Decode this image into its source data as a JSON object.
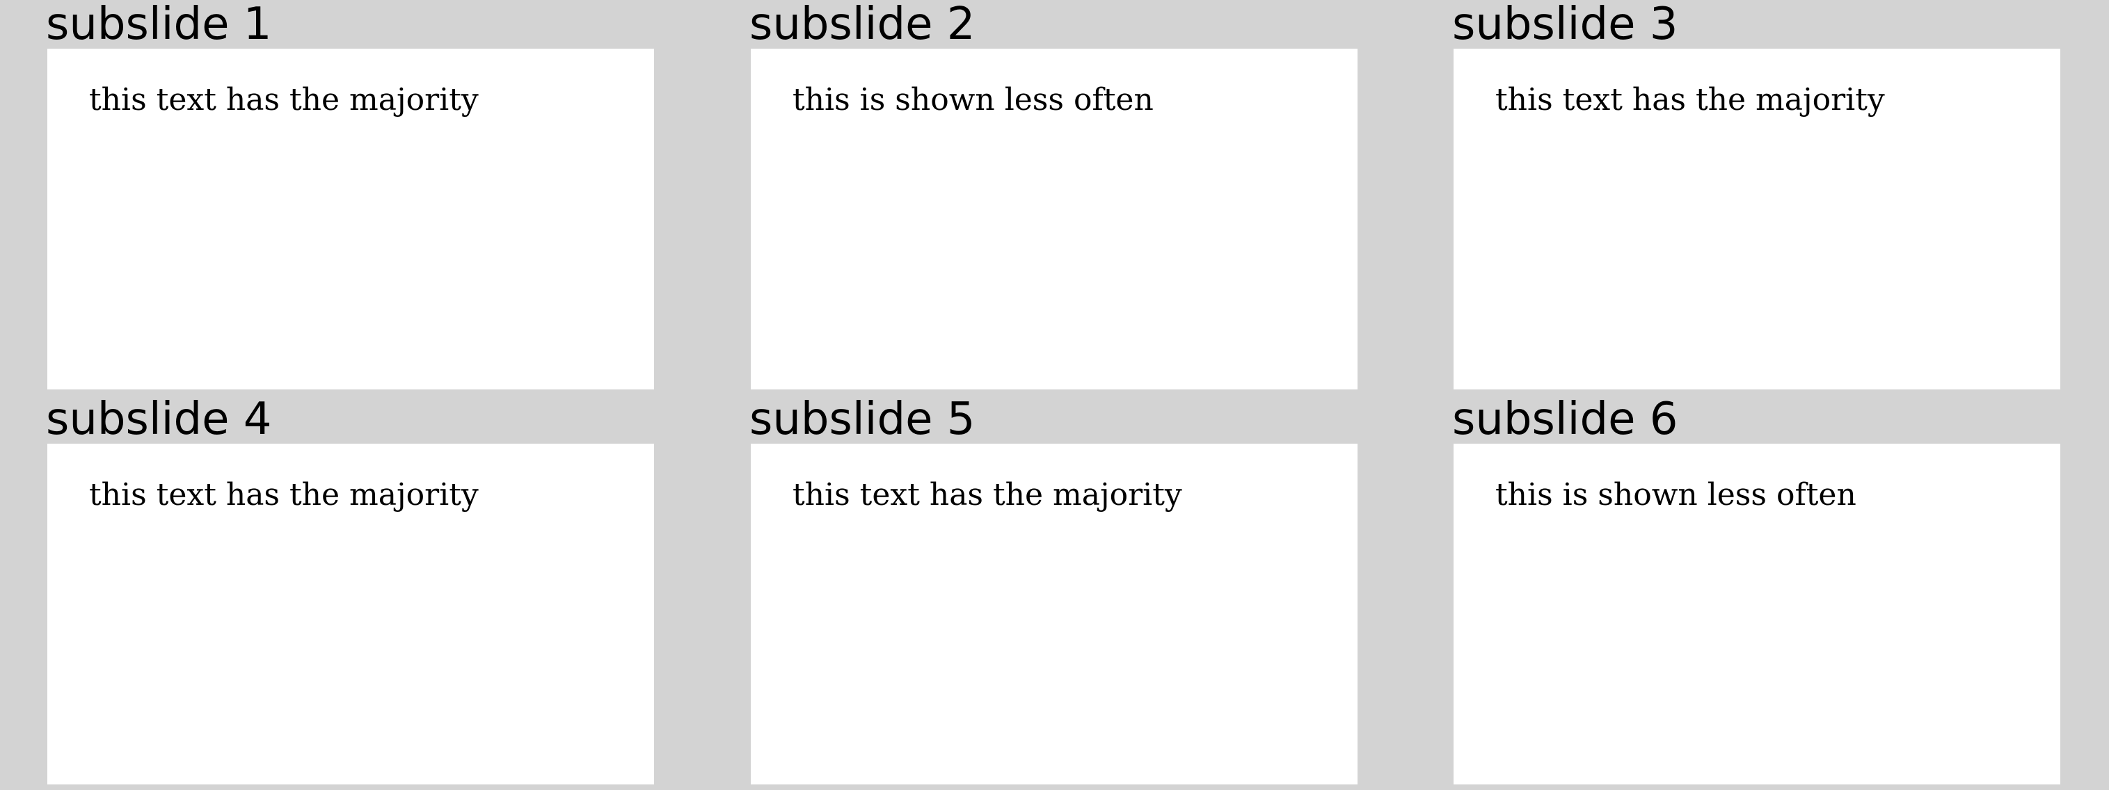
{
  "subslides": [
    {
      "title": "subslide 1",
      "text": "this text has the majority"
    },
    {
      "title": "subslide 2",
      "text": "this is shown less often"
    },
    {
      "title": "subslide 3",
      "text": "this text has the majority"
    },
    {
      "title": "subslide 4",
      "text": "this text has the majority"
    },
    {
      "title": "subslide 5",
      "text": "this text has the majority"
    },
    {
      "title": "subslide 6",
      "text": "this is shown less often"
    }
  ],
  "colors": {
    "background": "#d3d3d3",
    "slide": "#ffffff",
    "text": "#000000"
  }
}
